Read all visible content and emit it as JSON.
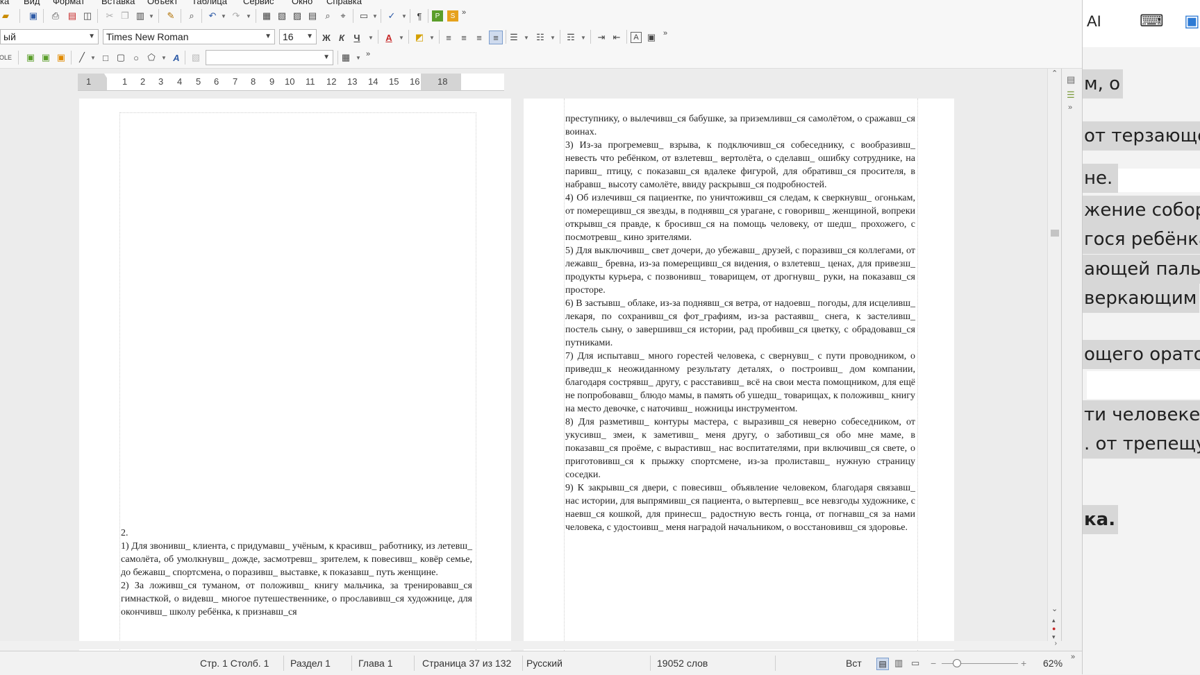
{
  "menubar": {
    "items": [
      "ка",
      "Вид",
      "Формат",
      "Вставка",
      "Объект",
      "Таблица",
      "Сервис",
      "Окно",
      "Справка"
    ]
  },
  "toolbar": {
    "paragraph_style": "ый",
    "font_name": "Times New Roman",
    "font_size": "16",
    "bold_label": "Ж",
    "italic_label": "К",
    "underline_label": "Ч",
    "font_color_label": "А",
    "insert_frame_label": "А",
    "fontwork_label": "А"
  },
  "ruler": {
    "labels": [
      "1",
      "1",
      "1",
      "2",
      "3",
      "4",
      "5",
      "6",
      "7",
      "8",
      "9",
      "10",
      "11",
      "12",
      "13",
      "14",
      "15",
      "16",
      "18"
    ]
  },
  "left_page": {
    "heading": "2.",
    "paragraphs": [
      "1) Для звонивш_ клиента, с придумавш_ учёным, к красивш_ работнику, из летевш_ самолёта, об умолкнувш_ дожде, засмотревш_ зрителем, к повесивш_ ковёр семье, до бежавш_ спортсмена, о поразивш_ выставке, к показавш_ путь женщине.",
      "2) За ложивш_ся туманом, от положивш_ книгу мальчика, за тренировавш_ся гимнасткой, о видевш_ многое путешественнике, о прославивш_ся художнице, для окончивш_ школу ребёнка, к признавш_ся"
    ]
  },
  "right_page": {
    "paragraphs": [
      "преступнику, о вылечивш_ся бабушке, за приземливш_ся самолётом, о сражавш_ся воинах.",
      "3) Из-за прогремевш_ взрыва, к подключивш_ся собеседнику, с вообразивш_ невесть что ребёнком, от взлетевш_ вертолёта, о сделавш_ ошибку сотруднике, на паривш_ птицу, с показавш_ся вдалеке фигурой, для обративш_ся просителя, в набравш_ высоту самолёте, ввиду раскрывш_ся подробностей.",
      "4) Об излечивш_ся пациентке, по уничтоживш_ся следам, к сверкнувш_ огонькам, от померещивш_ся звезды, в поднявш_ся урагане, с говоривш_ женщиной, вопреки открывш_ся правде, к бросивш_ся на помощь человеку, от шедш_ прохожего, с посмотревш_ кино зрителями.",
      "5) Для выключивш_ свет дочери, до убежавш_ друзей, с поразивш_ся коллегами, от лежавш_ бревна, из-за померещивш_ся видения, о взлетевш_ ценах, для привезш_ продукты курьера, с позвонивш_ товарищем, от дрогнувш_ руки, на показавш_ся просторе.",
      "6) В застывш_ облаке, из-за поднявш_ся ветра, от надоевш_ погоды, для исцеливш_ лекаря, по сохранивш_ся фот_графиям, из-за растаявш_ снега, к застеливш_ постель сыну, о завершивш_ся истории, рад пробивш_ся цветку, с обрадовавш_ся путниками.",
      "7) Для испытавш_ много горестей человека, с свернувш_ с пути проводником, о приведш_к неожиданному результату деталях, о построивш_ дом компании, благодаря сострявш_ другу, с расставивш_ всё на свои места помощником, для ещё не попробовавш_ блюдо мамы, в память об ушедш_ товарищах, к положивш_ книгу на место девочке, с наточивш_ ножницы инструментом.",
      "8) Для разметивш_ контуры мастера, с выразивш_ся неверно собеседником, от укусивш_ змеи, к заметивш_ меня другу, о заботивш_ся обо мне маме, в показавш_ся проёме, с вырастивш_ нас воспитателями, при включивш_ся свете, о приготовивш_ся к прыжку спортсмене, из-за пролиставш_ нужную страницу соседки.",
      "9) К закрывш_ся двери, с повесивш_ объявление человеком, благодаря связавш_ нас истории, для выпрямивш_ся пациента, о вытерпевш_ все невзгоды художнике, с наевш_ся кошкой, для принесш_ радостную весть гонца, от погнавш_ся за нами человека, с удостоивш_ меня наградой начальником, о восстановивш_ся здоровье."
    ]
  },
  "statusbar": {
    "position": "Стр. 1 Столб. 1",
    "section": "Раздел 1",
    "chapter": "Глава 1",
    "page": "Страница 37 из 132",
    "language": "Русский",
    "words": "19052 слов",
    "insert_mode": "Вст",
    "zoom": "62%",
    "zoom_minus": "−",
    "zoom_plus": "+"
  },
  "overlay": {
    "ai_label": "AI",
    "lines": [
      "м, о",
      "от терзающей",
      "не.",
      "жение собору,",
      "гося ребёнка.",
      "ающей пальто",
      "веркающим",
      "ощего оратор",
      "ти человеке, к",
      ". от трепещущ",
      "ка."
    ]
  }
}
